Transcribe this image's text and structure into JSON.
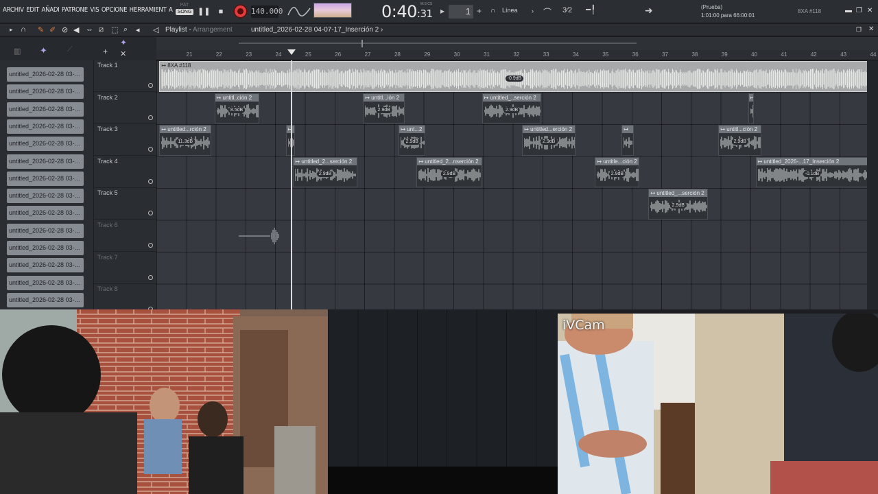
{
  "menu": {
    "items": [
      "ARCHIV",
      "EDIT",
      "AÑADI",
      "PATRONE",
      "VIS",
      "OPCIONE",
      "HERRAMIENT",
      "A"
    ]
  },
  "transport": {
    "mode_pat": "PAT",
    "mode_song": "SONG",
    "tempo": "140.000",
    "time_main": "0:40",
    "time_sub": ":31",
    "time_unit": "M:S:CS",
    "pattern_number": "1",
    "snap_label": "Línea",
    "snap_alt": "3⁄2"
  },
  "hint": {
    "line1": "(Prueba)",
    "line2": "1:01:00 para 66:00:01"
  },
  "plugin_tag": "8XA #118",
  "playlist": {
    "title": "Playlist",
    "subtitle": "Arrangement",
    "file": "untitled_2026-02-28 04-07-17_Inserción 2"
  },
  "picker_items": [
    "untitled_2026-02-28 03-…",
    "untitled_2026-02-28 03-…",
    "untitled_2026-02-28 03-…",
    "untitled_2026-02-28 03-…",
    "untitled_2026-02-28 03-…",
    "untitled_2026-02-28 03-…",
    "untitled_2026-02-28 03-…",
    "untitled_2026-02-28 03-…",
    "untitled_2026-02-28 03-…",
    "untitled_2026-02-28 03-…",
    "untitled_2026-02-28 03-…",
    "untitled_2026-02-28 03-…",
    "untitled_2026-02-28 03-…",
    "untitled_2026-02-28 03-…"
  ],
  "tracks": [
    {
      "name": "Track 1",
      "dim": false
    },
    {
      "name": "Track 2",
      "dim": false
    },
    {
      "name": "Track 3",
      "dim": false
    },
    {
      "name": "Track 4",
      "dim": false
    },
    {
      "name": "Track 5",
      "dim": false
    },
    {
      "name": "Track 6",
      "dim": true
    },
    {
      "name": "Track 7",
      "dim": true
    },
    {
      "name": "Track 8",
      "dim": true
    }
  ],
  "ruler": {
    "first_bar": 21,
    "last_bar": 44
  },
  "clips": [
    {
      "track": 1,
      "start": 20.95,
      "end": 44.8,
      "label": "8XA #118",
      "db": "-0.9dB",
      "big": true
    },
    {
      "track": 2,
      "start": 22.8,
      "end": 24.3,
      "label": "untitl..ción 2",
      "db": "8.5dB"
    },
    {
      "track": 2,
      "start": 27.8,
      "end": 29.2,
      "label": "untitl...ión 2",
      "db": "2.9dB"
    },
    {
      "track": 2,
      "start": 31.8,
      "end": 33.8,
      "label": "untitled_..serción 2",
      "db": "2.9dB"
    },
    {
      "track": 2,
      "start": 40.75,
      "end": 40.95,
      "label": "",
      "db": ""
    },
    {
      "track": 3,
      "start": 20.95,
      "end": 22.7,
      "label": "untitled...rción 2",
      "db": "11.3dB"
    },
    {
      "track": 3,
      "start": 25.2,
      "end": 25.5,
      "label": "",
      "db": ""
    },
    {
      "track": 3,
      "start": 29.0,
      "end": 29.9,
      "label": "unt...2",
      "db": "2.9dB"
    },
    {
      "track": 3,
      "start": 33.15,
      "end": 34.95,
      "label": "untitled...erción 2",
      "db": "2.9dB"
    },
    {
      "track": 3,
      "start": 36.5,
      "end": 36.9,
      "label": "",
      "db": ""
    },
    {
      "track": 3,
      "start": 39.75,
      "end": 41.2,
      "label": "untitl...ción 2",
      "db": "2.9dB"
    },
    {
      "track": 4,
      "start": 25.45,
      "end": 27.6,
      "label": "untitled_2...serción 2",
      "db": "2.9dB"
    },
    {
      "track": 4,
      "start": 29.6,
      "end": 31.8,
      "label": "untitled_2...nserción 2",
      "db": "2.9dB"
    },
    {
      "track": 4,
      "start": 35.6,
      "end": 37.1,
      "label": "untitle...ción 2",
      "db": "2.9dB"
    },
    {
      "track": 4,
      "start": 41.0,
      "end": 44.8,
      "label": "untitled_2026-...17_Inserción 2",
      "db": "-0.1dB"
    },
    {
      "track": 5,
      "start": 37.4,
      "end": 39.4,
      "label": "untitled_...serción 2",
      "db": "2.9dB"
    }
  ],
  "playhead_bar": 25.4,
  "webcam": {
    "overlay_label": "iVCam"
  },
  "colors": {
    "record": "#e33b3b",
    "accent_orange": "#e07b3d",
    "clip_header": "#70757c",
    "grid": "#363a40"
  }
}
